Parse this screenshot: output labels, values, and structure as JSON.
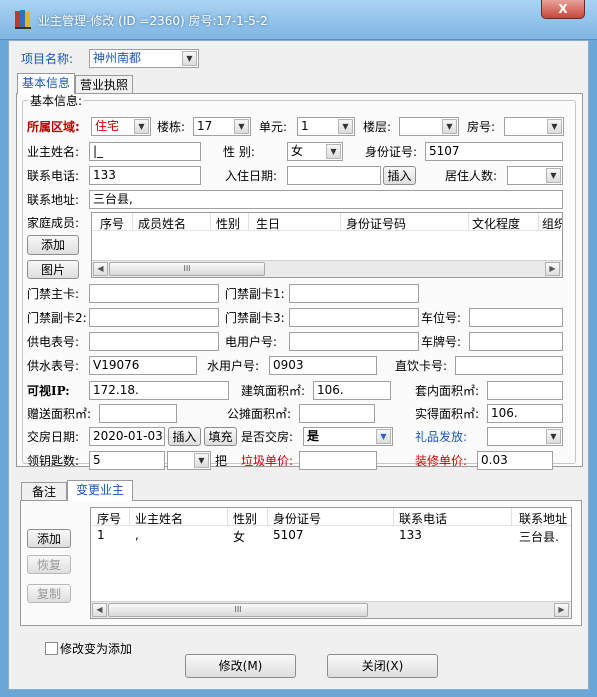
{
  "window": {
    "title": "业主管理-修改 (ID =2360)  房号:17-1-5-2",
    "close": "X"
  },
  "project": {
    "label": "项目名称:",
    "value": "神州南都"
  },
  "tabs": {
    "basic": "基本信息",
    "license": "营业执照"
  },
  "group_title": "基本信息:",
  "row1": {
    "area_label": "所属区域:",
    "area_value": "住宅",
    "building_label": "楼栋:",
    "building_value": "17",
    "unit_label": "单元:",
    "unit_value": "1",
    "floor_label": "楼层:",
    "floor_value": "",
    "room_label": "房号:",
    "room_value": ""
  },
  "row2": {
    "name_label": "业主姓名:",
    "name_value": "|_",
    "gender_label": "性    别:",
    "gender_value": "女",
    "id_label": "身份证号:",
    "id_value": "5107"
  },
  "row3": {
    "phone_label": "联系电话:",
    "phone_value": "133",
    "movein_label": "入住日期:",
    "movein_value": "",
    "insert_btn": "插入",
    "residents_label": "居住人数:",
    "residents_value": ""
  },
  "row4": {
    "address_label": "联系地址:",
    "address_value": "三台县,"
  },
  "family": {
    "label": "家庭成员:",
    "add_btn": "添加",
    "photo_btn": "图片",
    "columns": [
      "序号",
      "成员姓名",
      "性别",
      "生日",
      "身份证号码",
      "文化程度",
      "组织"
    ]
  },
  "access": {
    "main_label": "门禁主卡:",
    "main_value": "",
    "sub1_label": "门禁副卡1:",
    "sub1_value": "",
    "sub2_label": "门禁副卡2:",
    "sub2_value": "",
    "sub3_label": "门禁副卡3:",
    "sub3_value": "",
    "parking_label": "车位号:",
    "parking_value": ""
  },
  "meters": {
    "power_meter_label": "供电表号:",
    "power_meter_value": "",
    "power_account_label": "电用户号:",
    "power_account_value": "",
    "plate_label": "车牌号:",
    "plate_value": "",
    "water_meter_label": "供水表号:",
    "water_meter_value": "V19076",
    "water_account_label": "水用户号:",
    "water_account_value": "0903",
    "drink_label": "直饮卡号:",
    "drink_value": ""
  },
  "area": {
    "intercom_label": "可视IP:",
    "intercom_value": "172.18.",
    "build_area_label": "建筑面积㎡:",
    "build_area_value": "106.",
    "inner_area_label": "套内面积㎡:",
    "inner_area_value": "",
    "gift_area_label": "赠送面积㎡:",
    "gift_area_value": "",
    "shared_area_label": "公摊面积㎡:",
    "shared_area_value": "",
    "actual_area_label": "实得面积㎡:",
    "actual_area_value": "106."
  },
  "handover": {
    "date_label": "交房日期:",
    "date_value": "2020-01-03",
    "insert_btn": "插入",
    "fill_btn": "填充",
    "handed_label": "是否交房:",
    "handed_value": "是",
    "gift_label": "礼品发放:",
    "gift_value": ""
  },
  "keys": {
    "label": "领钥匙数:",
    "value": "5",
    "unit": "把",
    "garbage_label": "垃圾单价:",
    "garbage_value": "",
    "decor_label": "装修单价:",
    "decor_value": "0.03"
  },
  "bottom_tabs": {
    "remark": "备注",
    "change": "变更业主"
  },
  "change_buttons": {
    "add": "添加",
    "restore": "恢复",
    "copy": "复制"
  },
  "change_table": {
    "columns": [
      "序号",
      "业主姓名",
      "性别",
      "身份证号",
      "联系电话",
      "联系地址"
    ],
    "rows": [
      {
        "no": "1",
        "name": ",",
        "gender": "女",
        "id": "5107",
        "phone": "133",
        "address": "三台县."
      }
    ]
  },
  "footer": {
    "checkbox_label": "修改变为添加",
    "modify_btn": "修改(M)",
    "close_btn": "关闭(X)"
  },
  "scroll": {
    "left": "◀",
    "right": "▶",
    "grip": "III"
  }
}
